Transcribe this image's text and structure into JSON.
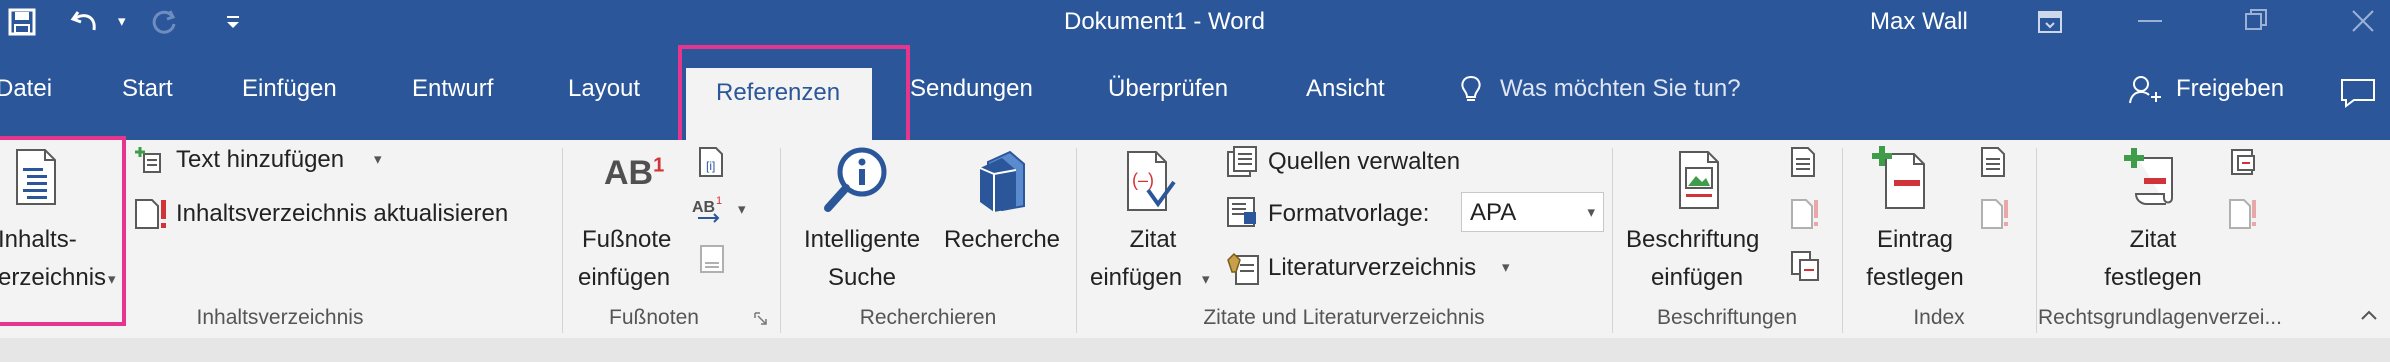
{
  "window": {
    "title": "Dokument1 - Word",
    "user": "Max Wall"
  },
  "tabs": [
    "Datei",
    "Start",
    "Einfügen",
    "Entwurf",
    "Layout",
    "Referenzen",
    "Sendungen",
    "Überprüfen",
    "Ansicht"
  ],
  "tell_me": "Was möchten Sie tun?",
  "share": "Freigeben",
  "toc": {
    "button_line1": "Inhalts-",
    "button_line2": "verzeichnis",
    "add_text": "Text hinzufügen",
    "update": "Inhaltsverzeichnis aktualisieren",
    "group": "Inhaltsverzeichnis"
  },
  "footnotes": {
    "line1": "Fußnote",
    "line2": "einfügen",
    "ab_label": "AB",
    "ab_sup": "1",
    "group": "Fußnoten"
  },
  "research": {
    "smart_line1": "Intelligente",
    "smart_line2": "Suche",
    "research": "Recherche",
    "group": "Recherchieren"
  },
  "citations": {
    "insert_line1": "Zitat",
    "insert_line2": "einfügen",
    "manage": "Quellen verwalten",
    "style_label": "Formatvorlage:",
    "style_value": "APA",
    "bibliography": "Literaturverzeichnis",
    "group": "Zitate und Literaturverzeichnis"
  },
  "captions": {
    "line1": "Beschriftung",
    "line2": "einfügen",
    "group": "Beschriftungen"
  },
  "index": {
    "line1": "Eintrag",
    "line2": "festlegen",
    "group": "Index"
  },
  "authorities": {
    "line1": "Zitat",
    "line2": "festlegen",
    "group": "Rechtsgrundlagenverzei..."
  }
}
